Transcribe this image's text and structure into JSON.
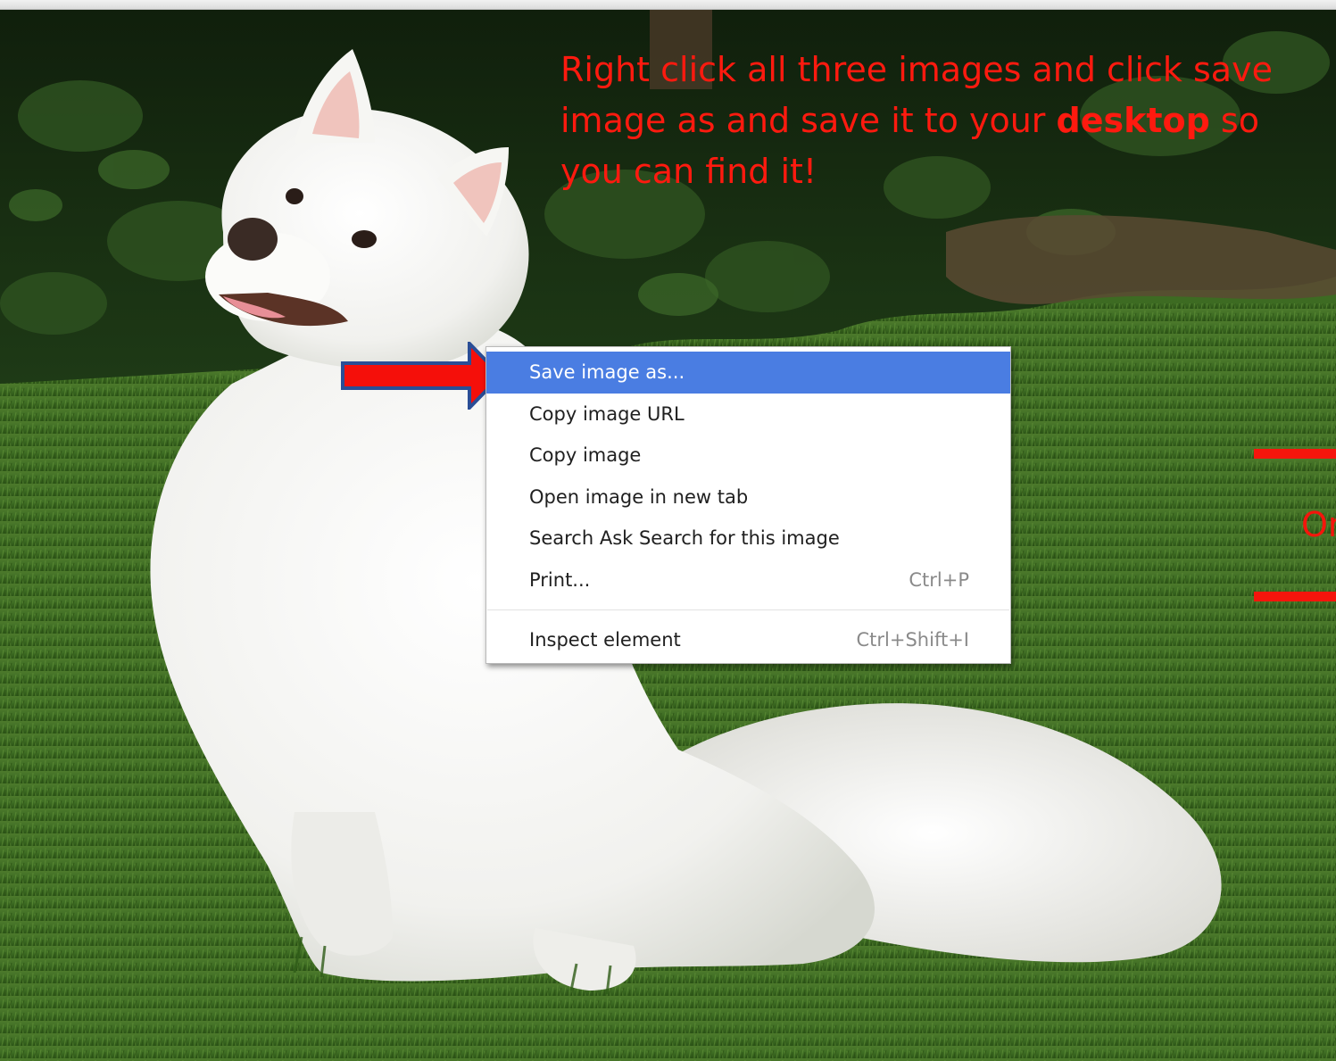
{
  "instruction": {
    "before": "Right click all three images and click save image as and save it to your ",
    "bold": "desktop",
    "after": " so you can find it!"
  },
  "edge_text": "Or",
  "context_menu": {
    "items": [
      {
        "label": "Save image as...",
        "shortcut": ""
      },
      {
        "label": "Copy image URL",
        "shortcut": ""
      },
      {
        "label": "Copy image",
        "shortcut": ""
      },
      {
        "label": "Open image in new tab",
        "shortcut": ""
      },
      {
        "label": "Search Ask Search for this image",
        "shortcut": ""
      },
      {
        "label": "Print...",
        "shortcut": "Ctrl+P"
      },
      {
        "label": "Inspect element",
        "shortcut": "Ctrl+Shift+I"
      }
    ]
  },
  "colors": {
    "annotation_red": "#ff1a0f",
    "menu_highlight": "#4a7de2",
    "arrow_outline": "#2a4e96"
  }
}
